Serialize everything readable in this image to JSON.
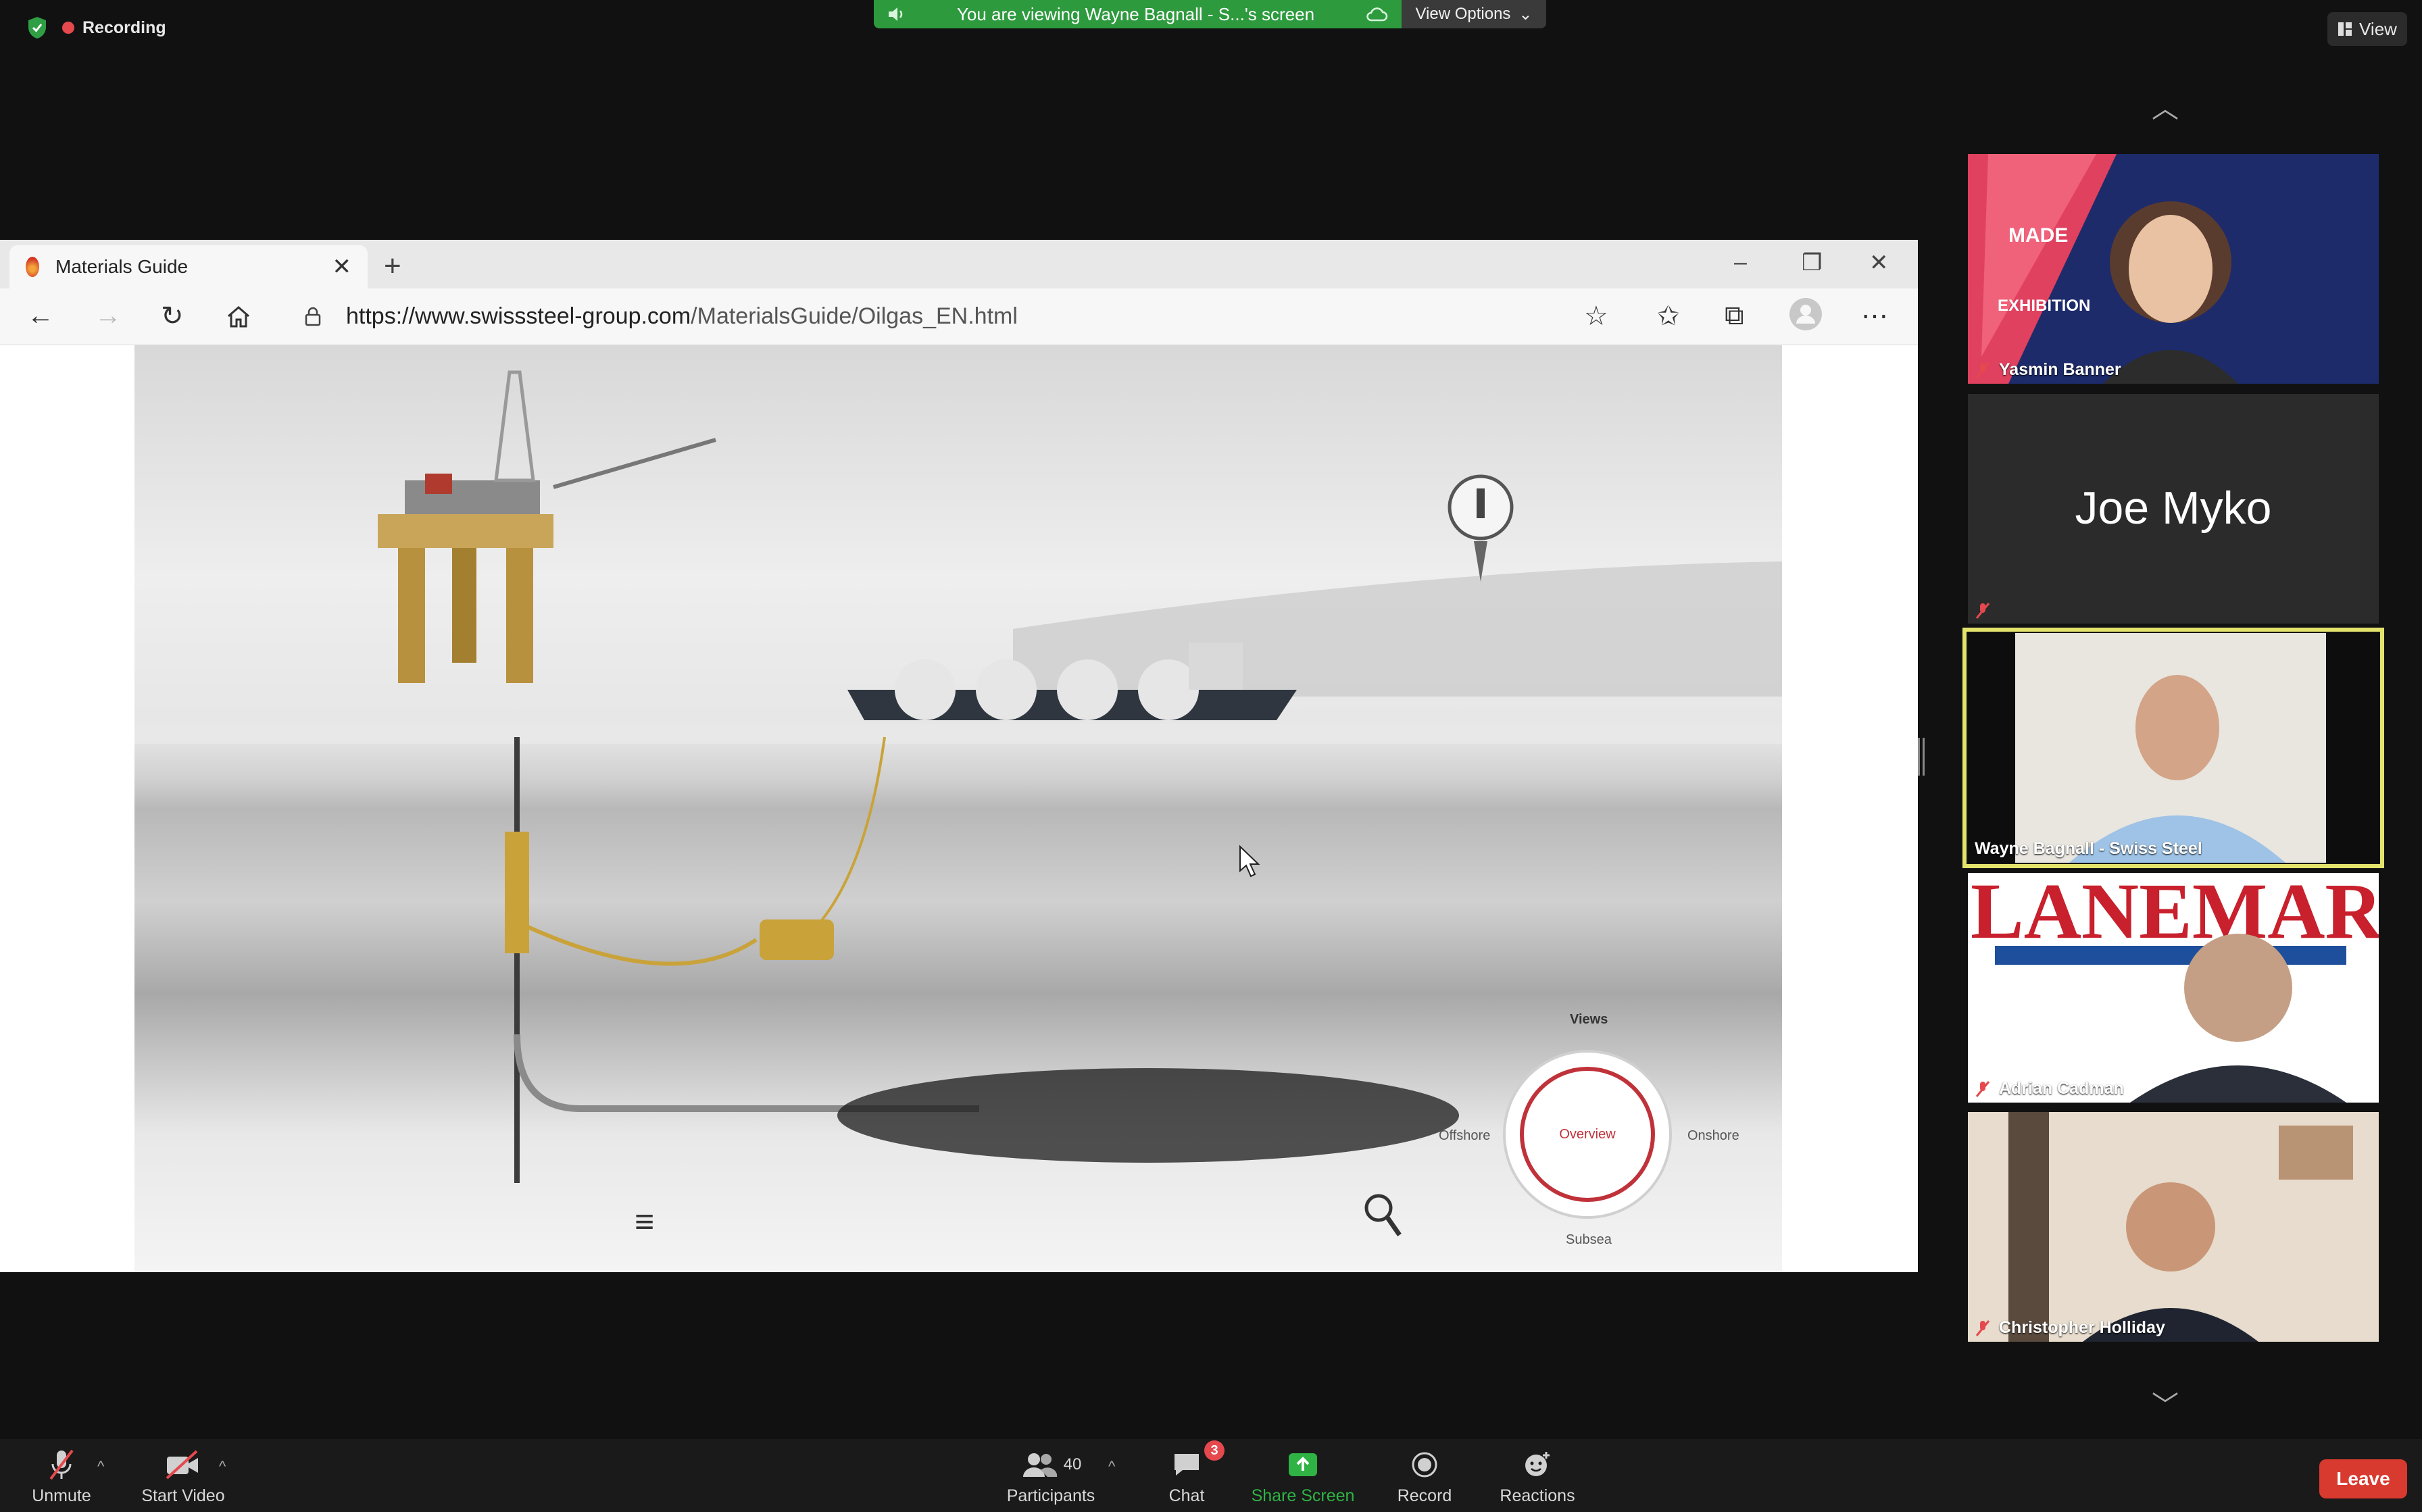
{
  "meeting": {
    "recording_label": "Recording",
    "share_banner": "You are viewing Wayne Bagnall - S...'s screen",
    "view_options_label": "View Options",
    "view_label": "View"
  },
  "browser": {
    "tab_title": "Materials Guide",
    "url_host": "https://www.swisssteel-group.com",
    "url_path": "/MaterialsGuide/Oilgas_EN.html"
  },
  "scene": {
    "views_title": "Views",
    "center_label": "Overview",
    "left_label": "Offshore",
    "right_label": "Onshore",
    "bottom_label": "Subsea"
  },
  "participants": [
    {
      "name": "Yasmin Banner",
      "muted": true,
      "video": true
    },
    {
      "name": "Joe Myko",
      "muted": true,
      "video": false
    },
    {
      "name": "Wayne Bagnall - Swiss Steel",
      "muted": false,
      "video": true,
      "active_speaker": true
    },
    {
      "name": "Adrian Cadman",
      "muted": true,
      "video": true
    },
    {
      "name": "Christopher Holliday",
      "muted": true,
      "video": true
    }
  ],
  "toolbar": {
    "unmute_label": "Unmute",
    "start_video_label": "Start Video",
    "participants_label": "Participants",
    "participants_count": "40",
    "chat_label": "Chat",
    "chat_badge": "3",
    "share_screen_label": "Share Screen",
    "record_label": "Record",
    "reactions_label": "Reactions",
    "leave_label": "Leave"
  },
  "colors": {
    "accent_green": "#2d9a3e",
    "leave_red": "#d93a30",
    "active_speaker_border": "#e4e46d",
    "overview_ring": "#c0323a"
  }
}
